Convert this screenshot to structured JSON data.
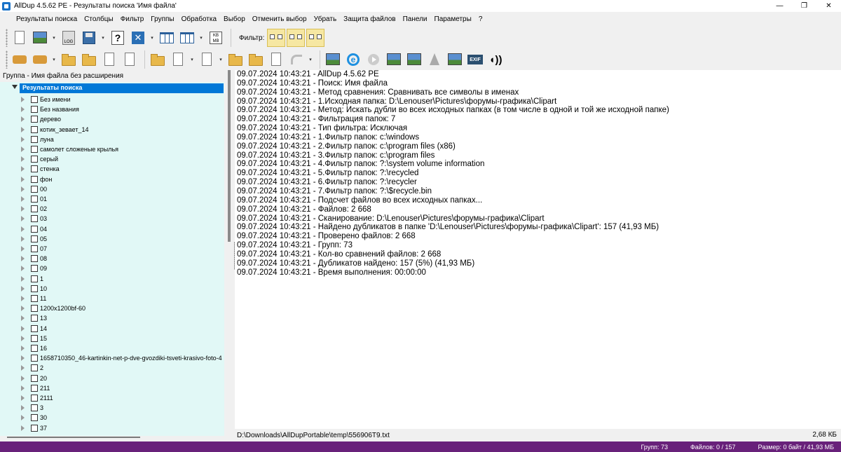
{
  "titlebar": {
    "title": "AllDup 4.5.62 PE - Результаты поиска 'Имя файла'",
    "minimize": "—",
    "maximize": "❐",
    "close": "✕"
  },
  "menu": [
    "Результаты поиска",
    "Столбцы",
    "Фильтр",
    "Группы",
    "Обработка",
    "Выбор",
    "Отменить выбор",
    "Убрать",
    "Защита файлов",
    "Панели",
    "Параметры",
    "?"
  ],
  "toolbar": {
    "filter_label": "Фильтр:",
    "log_label": "LOG",
    "kb_label": "KB MB",
    "exif_label": "EXIF",
    "sound_glyph": "◖))",
    "help_glyph": "?",
    "delete_glyph": "✕",
    "ie_glyph": "e",
    "dropdown_glyph": "▾"
  },
  "left_panel": {
    "header": "Группа - Имя файла без расширения",
    "root": "Результаты поиска",
    "items": [
      "Без имени",
      "Без названия",
      "дерево",
      "котик_зевает_14",
      "луна",
      "самолет сложеные крылья",
      "серый",
      "стенка",
      "фон",
      "00",
      "01",
      "02",
      "03",
      "04",
      "05",
      "07",
      "08",
      "09",
      "1",
      "10",
      "11",
      "1200x1200bf-60",
      "13",
      "14",
      "15",
      "16",
      "1658710350_46-kartinkin-net-p-dve-gvozdiki-tsveti-krasivo-foto-4",
      "2",
      "20",
      "211",
      "2111",
      "3",
      "30",
      "37"
    ]
  },
  "log": [
    "09.07.2024 10:43:21 - AllDup 4.5.62 PE",
    "09.07.2024 10:43:21 - Поиск: Имя файла",
    "09.07.2024 10:43:21 - Метод сравнения: Сравнивать все символы в именах",
    "09.07.2024 10:43:21 - 1.Исходная папка: D:\\Lenouser\\Pictures\\форумы-графика\\Clipart",
    "09.07.2024 10:43:21 - Метод: Искать дубли во всех исходных папках (в том числе в одной и той же исходной папке)",
    "09.07.2024 10:43:21 - Фильтрация папок: 7",
    "09.07.2024 10:43:21 - Тип фильтра: Исключая",
    "09.07.2024 10:43:21 - 1.Фильтр папок: c:\\windows",
    "09.07.2024 10:43:21 - 2.Фильтр папок: c:\\program files (x86)",
    "09.07.2024 10:43:21 - 3.Фильтр папок: c:\\program files",
    "09.07.2024 10:43:21 - 4.Фильтр папок: ?:\\system volume information",
    "09.07.2024 10:43:21 - 5.Фильтр папок: ?:\\recycled",
    "09.07.2024 10:43:21 - 6.Фильтр папок: ?:\\recycler",
    "09.07.2024 10:43:21 - 7.Фильтр папок: ?:\\$recycle.bin",
    "09.07.2024 10:43:21 - Подсчет файлов во всех исходных папках...",
    "09.07.2024 10:43:21 - Файлов: 2 668",
    "09.07.2024 10:43:21 - Сканирование: D:\\Lenouser\\Pictures\\форумы-графика\\Clipart",
    "09.07.2024 10:43:21 - Найдено дубликатов в папке 'D:\\Lenouser\\Pictures\\форумы-графика\\Clipart': 157 (41,93 МБ)",
    "09.07.2024 10:43:21 - Проверено файлов: 2 668",
    "09.07.2024 10:43:21 - Групп: 73",
    "09.07.2024 10:43:21 - Кол-во сравнений файлов: 2 668",
    "09.07.2024 10:43:21 - Дубликатов найдено: 157 (5%) (41,93 МБ)",
    "09.07.2024 10:43:21 - Время выполнения: 00:00:00"
  ],
  "pathbar": {
    "path": "D:\\Downloads\\AllDupPortable\\temp\\556906T9.txt",
    "size": "2,68 КБ"
  },
  "status": {
    "groups": "Групп: 73",
    "files": "Файлов: 0 / 157",
    "size": "Размер: 0 байт / 41,93 МБ"
  },
  "colors": {
    "status_bar": "#68217a",
    "tree_bg": "#e1f8f6",
    "selection": "#0078d7",
    "filter_btn": "#f6e7a2"
  }
}
